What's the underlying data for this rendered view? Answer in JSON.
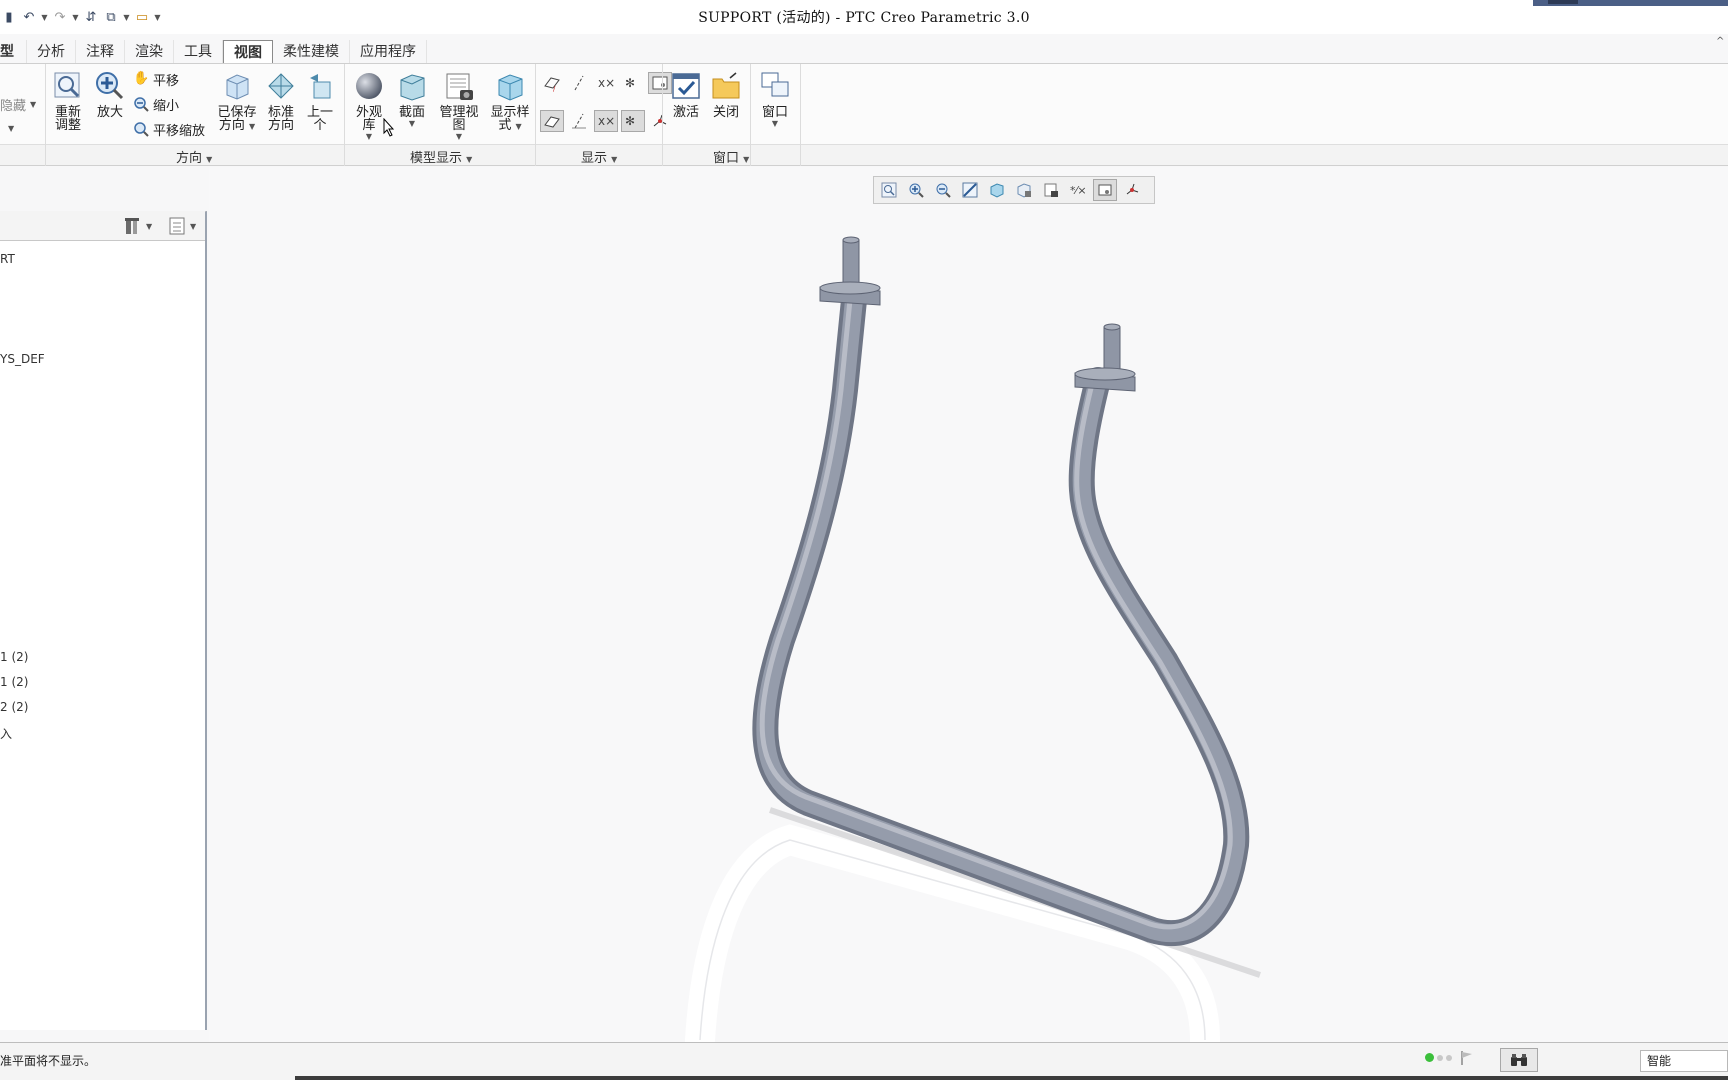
{
  "window": {
    "title": "SUPPORT (活动的) - PTC Creo Parametric 3.0"
  },
  "tabs": [
    {
      "label": "型"
    },
    {
      "label": "分析"
    },
    {
      "label": "注释"
    },
    {
      "label": "渲染"
    },
    {
      "label": "工具"
    },
    {
      "label": "视图"
    },
    {
      "label": "柔性建模"
    },
    {
      "label": "应用程序"
    }
  ],
  "ribbon": {
    "hide_label": "隐藏",
    "orientation": {
      "refit_l1": "重新",
      "refit_l2": "调整",
      "zoom_in": "放大",
      "pan": "平移",
      "zoom_out": "缩小",
      "pan_zoom": "平移缩放",
      "saved_l1": "已保存",
      "saved_l2": "方向",
      "std_l1": "标准",
      "std_l2": "方向",
      "prev_l1": "上一",
      "prev_l2": "个",
      "group_label": "方向"
    },
    "model_display": {
      "appearance": "外观库",
      "section": "截面",
      "manage_views": "管理视图",
      "display_style_l1": "显示样",
      "display_style_l2": "式",
      "group_label": "模型显示"
    },
    "show": {
      "group_label": "显示"
    },
    "window": {
      "activate": "激活",
      "close": "关闭",
      "windows": "窗口",
      "group_label": "窗口"
    }
  },
  "tree": {
    "items": [
      {
        "label": "RT"
      },
      {
        "label": "YS_DEF"
      },
      {
        "label": "1 (2)"
      },
      {
        "label": "1 (2)"
      },
      {
        "label": "2 (2)"
      },
      {
        "label": "入"
      }
    ]
  },
  "status": {
    "message": "准平面将不显示。",
    "filter": "智能"
  },
  "colors": {
    "tube": "#8c93a3",
    "active_tab_border": "#8a8a8a",
    "status_green": "#3bbf3b"
  }
}
